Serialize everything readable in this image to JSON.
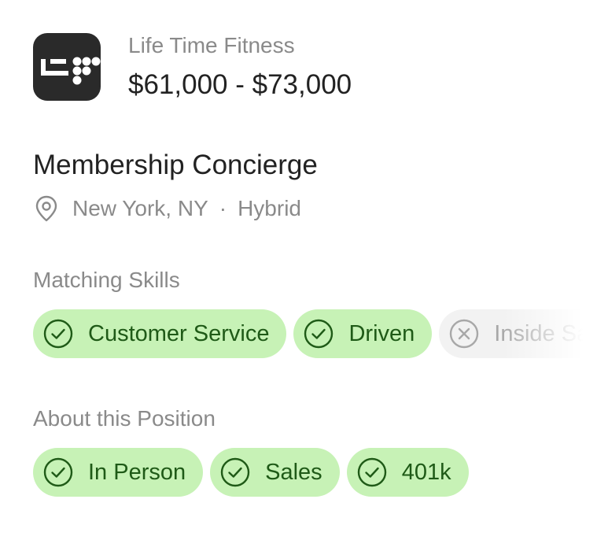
{
  "company": {
    "name": "Life Time Fitness",
    "logo_icon": "life-time-logo",
    "salary": "$61,000 - $73,000"
  },
  "job": {
    "title": "Membership Concierge",
    "location": "New York, NY",
    "separator": "·",
    "work_type": "Hybrid",
    "location_icon": "map-pin-icon"
  },
  "matching_skills": {
    "label": "Matching Skills",
    "items": [
      {
        "label": "Customer Service",
        "matched": true
      },
      {
        "label": "Driven",
        "matched": true
      },
      {
        "label": "Inside Sales",
        "matched": false
      }
    ]
  },
  "about_position": {
    "label": "About this Position",
    "items": [
      {
        "label": "In Person",
        "matched": true
      },
      {
        "label": "Sales",
        "matched": true
      },
      {
        "label": "401k",
        "matched": true
      }
    ]
  },
  "colors": {
    "match_bg": "#c7f2b6",
    "match_text": "#1f5a17",
    "nomatch_bg": "#f2f2f2",
    "nomatch_text": "#a8a8a8",
    "logo_bg": "#2a2a2a"
  }
}
